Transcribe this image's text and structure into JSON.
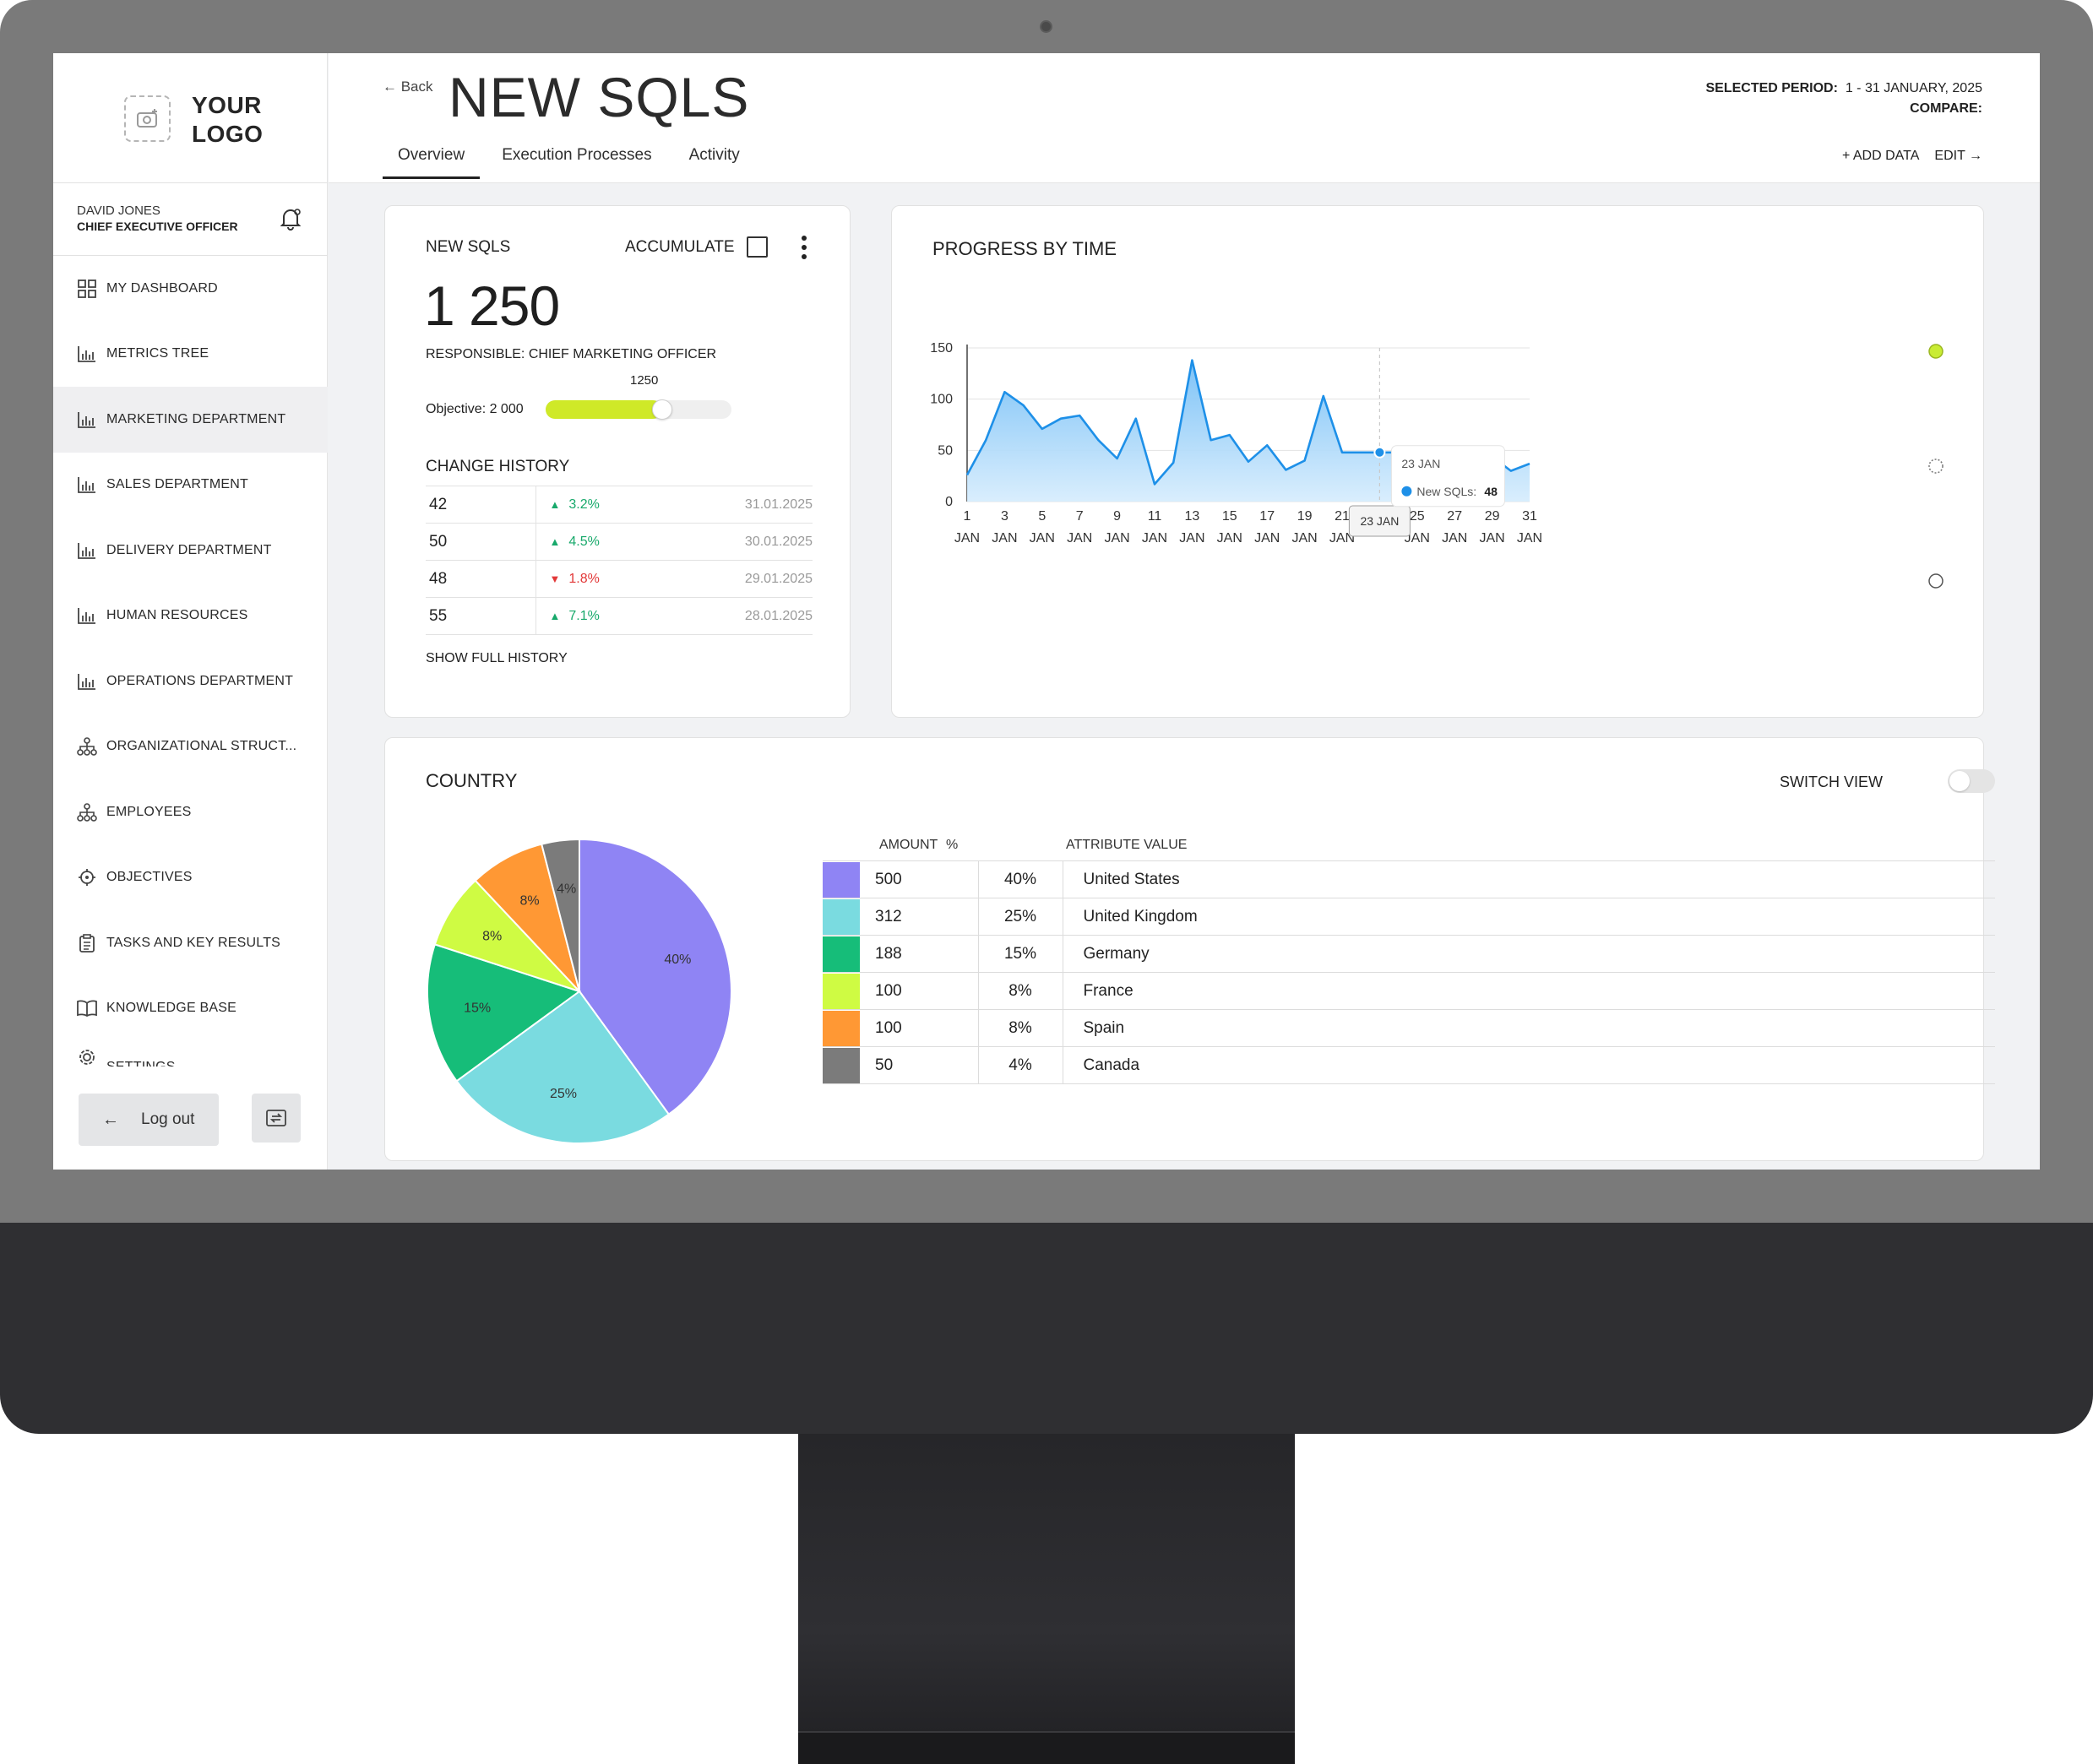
{
  "sidebar": {
    "logo_text": "YOUR LOGO",
    "user_name": "DAVID JONES",
    "user_role": "CHIEF EXECUTIVE OFFICER",
    "items": [
      {
        "label": "MY DASHBOARD",
        "icon": "grid-icon"
      },
      {
        "label": "METRICS TREE",
        "icon": "bar-chart-icon"
      },
      {
        "label": "MARKETING DEPARTMENT",
        "icon": "bar-chart-icon",
        "active": true
      },
      {
        "label": "SALES DEPARTMENT",
        "icon": "bar-chart-icon"
      },
      {
        "label": "DELIVERY DEPARTMENT",
        "icon": "bar-chart-icon"
      },
      {
        "label": "HUMAN RESOURCES",
        "icon": "bar-chart-icon"
      },
      {
        "label": "OPERATIONS DEPARTMENT",
        "icon": "bar-chart-icon"
      },
      {
        "label": "ORGANIZATIONAL STRUCT...",
        "icon": "org-chart-icon"
      },
      {
        "label": "EMPLOYEES",
        "icon": "org-chart-icon"
      },
      {
        "label": "OBJECTIVES",
        "icon": "target-icon"
      },
      {
        "label": "TASKS AND KEY RESULTS",
        "icon": "clipboard-icon"
      },
      {
        "label": "KNOWLEDGE BASE",
        "icon": "book-icon"
      },
      {
        "label": "SETTINGS",
        "icon": "settings-icon"
      }
    ],
    "logout_label": "Log out"
  },
  "header": {
    "back_label": "← Back",
    "title": "NEW SQLS",
    "tabs": [
      {
        "label": "Overview",
        "active": true
      },
      {
        "label": "Execution Processes"
      },
      {
        "label": "Activity"
      }
    ],
    "selected_period_label": "SELECTED PERIOD:",
    "selected_period_value": "1 - 31 JANUARY, 2025",
    "compare_label": "COMPARE:",
    "add_data_label": "+ ADD DATA",
    "edit_label": "EDIT →"
  },
  "kpi": {
    "title": "NEW SQLS",
    "accumulate_label": "ACCUMULATE",
    "value": "1 250",
    "responsible": "RESPONSIBLE: CHIEF MARKETING OFFICER",
    "bar_value": "1250",
    "objective": "Objective: 2 000",
    "progress_fraction": 0.625,
    "history_title": "CHANGE HISTORY",
    "history": [
      {
        "value": "42",
        "change": "3.2%",
        "direction": "up",
        "date": "31.01.2025"
      },
      {
        "value": "50",
        "change": "4.5%",
        "direction": "up",
        "date": "30.01.2025"
      },
      {
        "value": "48",
        "change": "1.8%",
        "direction": "down",
        "date": "29.01.2025"
      },
      {
        "value": "55",
        "change": "7.1%",
        "direction": "up",
        "date": "28.01.2025"
      }
    ],
    "show_history_label": "SHOW FULL HISTORY"
  },
  "progress": {
    "title": "PROGRESS BY TIME",
    "tooltip_date": "23 JAN",
    "tooltip_series": "New SQLs:",
    "tooltip_value": "48",
    "hover_label": "23 JAN"
  },
  "chart_data": [
    {
      "type": "area",
      "title": "PROGRESS BY TIME",
      "x": [
        1,
        2,
        3,
        4,
        5,
        6,
        7,
        8,
        9,
        10,
        11,
        12,
        13,
        14,
        15,
        16,
        17,
        18,
        19,
        20,
        21,
        22,
        23,
        24,
        25,
        26,
        27,
        28,
        29,
        30,
        31
      ],
      "series": [
        {
          "name": "New SQLs",
          "values": [
            26,
            60,
            107,
            94,
            71,
            81,
            84,
            60,
            42,
            81,
            17,
            38,
            138,
            60,
            65,
            39,
            55,
            31,
            40,
            103,
            48,
            48,
            48,
            48,
            38,
            52,
            48,
            40,
            44,
            30,
            37
          ]
        }
      ],
      "x_tick_labels": [
        "1",
        "3",
        "5",
        "7",
        "9",
        "11",
        "13",
        "15",
        "17",
        "19",
        "21",
        "23",
        "25",
        "27",
        "29",
        "31"
      ],
      "x_tick_sublabel": "JAN",
      "y_ticks": [
        0,
        50,
        100,
        150
      ],
      "ylim": [
        0,
        150
      ],
      "grid": true,
      "color": "#1e90e8"
    },
    {
      "type": "pie",
      "title": "COUNTRY",
      "categories": [
        "United States",
        "United Kingdom",
        "Germany",
        "France",
        "Spain",
        "Canada"
      ],
      "values": [
        500,
        312,
        188,
        100,
        100,
        50
      ],
      "percents": [
        "40%",
        "25%",
        "15%",
        "8%",
        "8%",
        "4%"
      ],
      "colors": [
        "#8f84f4",
        "#7adbe0",
        "#16bd79",
        "#cffb43",
        "#ff9834",
        "#7b7b7b"
      ]
    }
  ],
  "country": {
    "title": "COUNTRY",
    "switch_label": "SWITCH VIEW",
    "columns": [
      "AMOUNT",
      "%",
      "ATTRIBUTE VALUE"
    ]
  }
}
